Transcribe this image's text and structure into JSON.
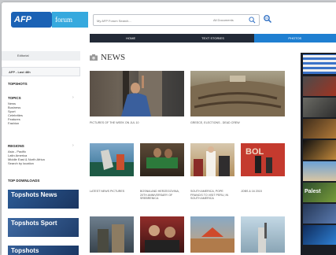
{
  "header": {
    "logo_text": "AFP",
    "forum_text": "forum",
    "search_placeholder": "My AFP Forum Search...",
    "search_scope": "All Documents"
  },
  "nav": {
    "tabs": [
      {
        "label": "Home",
        "active": false
      },
      {
        "label": "Text Stories",
        "active": false
      },
      {
        "label": "Photos",
        "active": true
      }
    ]
  },
  "sidebar": {
    "editorial": "Editorial",
    "service": "AFP - Last 48h",
    "topshots_heading": "Topshots",
    "topics_heading": "Topics",
    "topics": [
      "News",
      "Business",
      "Sport",
      "Celebrities",
      "Features",
      "Fashion"
    ],
    "regions_heading": "Regions",
    "regions": [
      "Asia - Pacific",
      "Latin America",
      "Middle East & North Africa",
      "Search by location"
    ],
    "downloads_heading": "Top downloads",
    "tiles": [
      "Topshots News",
      "Topshots Sport",
      "Topshots"
    ]
  },
  "main": {
    "title": "NEWS",
    "captions": [
      "PICTURES OF THE WEEK ON JUL 10",
      "GREECE, Elections - Dead Crew",
      "LATEST NEWS PICTURES",
      "BOSNIA AND HERZEGOVINA, 20th anniversary of Srebrenica",
      "SOUTH AMERICA, Pope Francis to visit Peru, in South America",
      "Jobs & 16 2015",
      "",
      "",
      "",
      ""
    ]
  },
  "right_column": {
    "label": "Palest"
  }
}
